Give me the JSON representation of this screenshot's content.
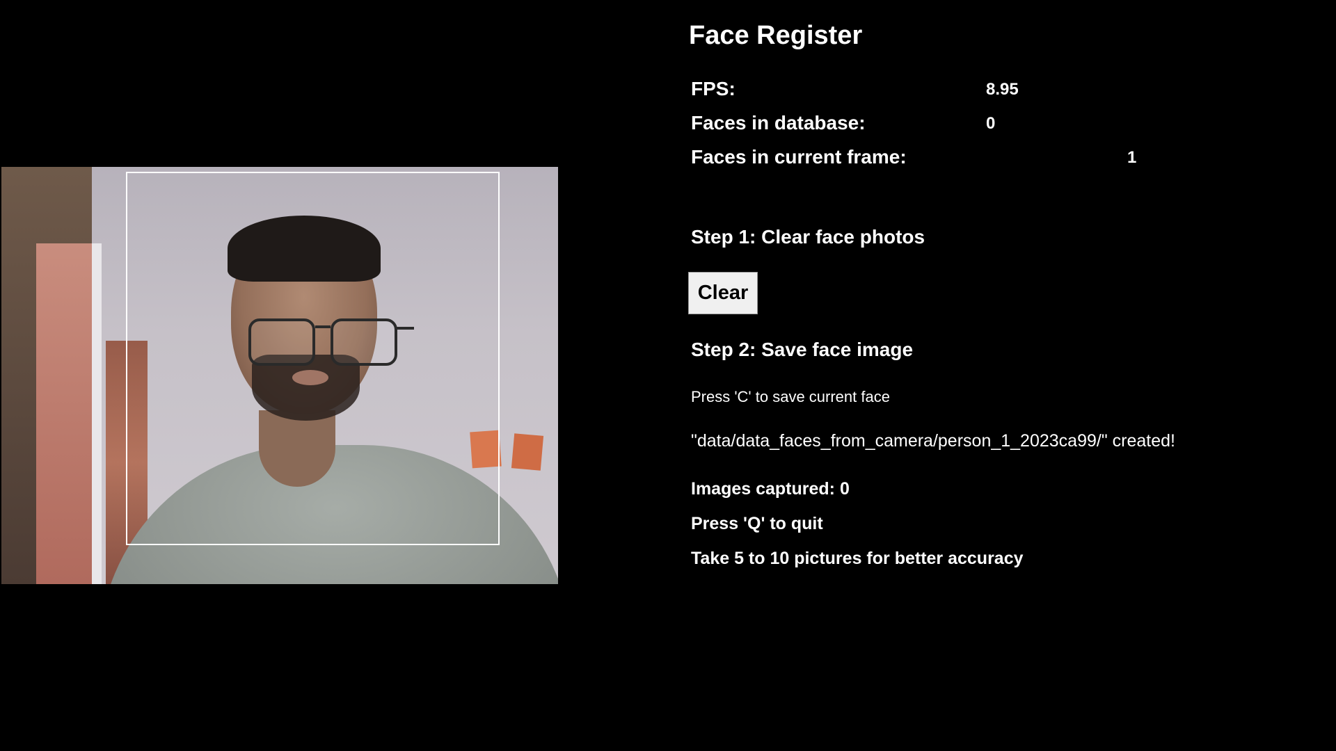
{
  "title": "Face Register",
  "stats": {
    "fps_label": "FPS:",
    "fps_value": "8.95",
    "db_label": "Faces in database:",
    "db_value": "0",
    "frame_label": "Faces in current frame:",
    "frame_value": "1"
  },
  "step1": {
    "heading": "Step 1: Clear face photos",
    "clear_label": "Clear"
  },
  "step2": {
    "heading": "Step 2: Save face image",
    "save_hint": "Press 'C' to save current face",
    "created_msg": "\"data/data_faces_from_camera/person_1_2023ca99/\" created!",
    "images_captured": "Images captured: 0",
    "quit_hint": "Press 'Q' to quit",
    "accuracy_tip": "Take 5 to 10 pictures for better accuracy"
  },
  "colors": {
    "background": "#000000",
    "text": "#ffffff",
    "button_bg": "#f0f0f0",
    "face_box": "#ffffff"
  }
}
